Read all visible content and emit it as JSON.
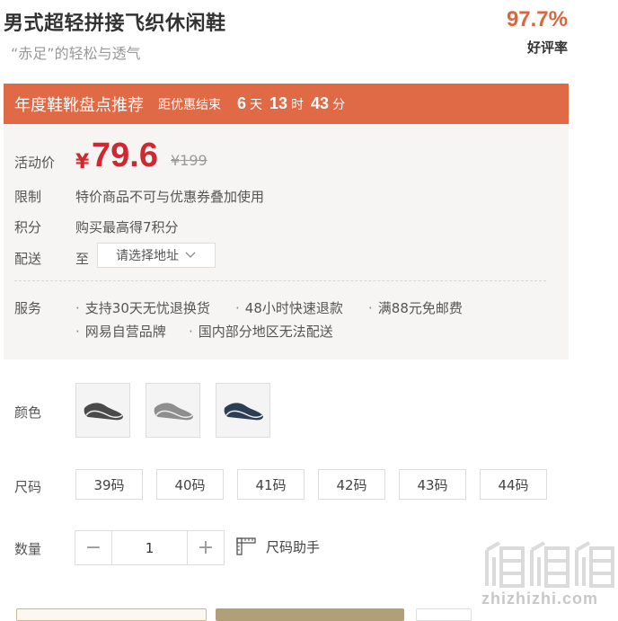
{
  "product": {
    "title": "男式超轻拼接飞织休闲鞋",
    "subtitle": "“赤足”的轻松与透气",
    "rating_value": "97.7%",
    "rating_label": "好评率"
  },
  "promo": {
    "title": "年度鞋靴盘点推荐",
    "countdown_label": "距优惠结束",
    "days": "6",
    "days_unit": "天",
    "hours": "13",
    "hours_unit": "时",
    "minutes": "43",
    "minutes_unit": "分"
  },
  "price": {
    "label": "活动价",
    "symbol": "¥",
    "value": "79.6",
    "original": "¥199"
  },
  "info": {
    "limit_label": "限制",
    "limit_value": "特价商品不可与优惠券叠加使用",
    "points_label": "积分",
    "points_value": "购买最高得7积分",
    "delivery_label": "配送",
    "delivery_prefix": "至",
    "address_placeholder": "请选择地址"
  },
  "service": {
    "label": "服务",
    "items": [
      "支持30天无忧退换货",
      "48小时快速退款",
      "满88元免邮费",
      "网易自营品牌",
      "国内部分地区无法配送"
    ]
  },
  "color": {
    "label": "颜色",
    "swatches": [
      "dark-gray",
      "light-gray",
      "navy"
    ]
  },
  "size": {
    "label": "尺码",
    "options": [
      "39码",
      "40码",
      "41码",
      "42码",
      "43码",
      "44码"
    ]
  },
  "quantity": {
    "label": "数量",
    "value": "1",
    "minus": "−",
    "plus": "+"
  },
  "size_helper": "尺码助手",
  "watermark": "zhizhizhi.com",
  "colors": {
    "accent": "#e06a45",
    "price": "#d0282e",
    "rating": "#d9663e",
    "panel": "#f6f5f3"
  }
}
